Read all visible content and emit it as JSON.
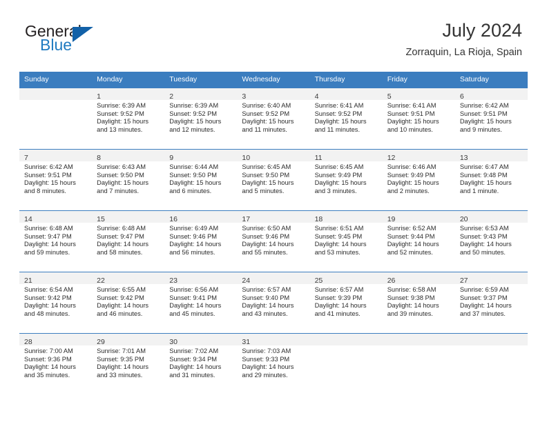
{
  "brand": {
    "name_part1": "General",
    "name_part2": "Blue",
    "flag_icon": "blue-triangle-flag-icon",
    "accent_color": "#1261a8",
    "text_color": "#231f20"
  },
  "header": {
    "title": "July 2024",
    "subtitle": "Zorraquin, La Rioja, Spain"
  },
  "theme": {
    "header_row_bg": "#3b7dbf",
    "header_row_text": "#ffffff",
    "daynum_band_bg": "#f2f2f2",
    "cell_border": "#3b7dbf",
    "body_text": "#2b2b2b"
  },
  "weekday_headers": [
    "Sunday",
    "Monday",
    "Tuesday",
    "Wednesday",
    "Thursday",
    "Friday",
    "Saturday"
  ],
  "labels": {
    "sunrise_prefix": "Sunrise:",
    "sunset_prefix": "Sunset:",
    "daylight_prefix": "Daylight:"
  },
  "weeks": [
    [
      {
        "day": "",
        "sunrise": "",
        "sunset": "",
        "daylight_line1": "",
        "daylight_line2": ""
      },
      {
        "day": "1",
        "sunrise": "Sunrise: 6:39 AM",
        "sunset": "Sunset: 9:52 PM",
        "daylight_line1": "Daylight: 15 hours",
        "daylight_line2": "and 13 minutes."
      },
      {
        "day": "2",
        "sunrise": "Sunrise: 6:39 AM",
        "sunset": "Sunset: 9:52 PM",
        "daylight_line1": "Daylight: 15 hours",
        "daylight_line2": "and 12 minutes."
      },
      {
        "day": "3",
        "sunrise": "Sunrise: 6:40 AM",
        "sunset": "Sunset: 9:52 PM",
        "daylight_line1": "Daylight: 15 hours",
        "daylight_line2": "and 11 minutes."
      },
      {
        "day": "4",
        "sunrise": "Sunrise: 6:41 AM",
        "sunset": "Sunset: 9:52 PM",
        "daylight_line1": "Daylight: 15 hours",
        "daylight_line2": "and 11 minutes."
      },
      {
        "day": "5",
        "sunrise": "Sunrise: 6:41 AM",
        "sunset": "Sunset: 9:51 PM",
        "daylight_line1": "Daylight: 15 hours",
        "daylight_line2": "and 10 minutes."
      },
      {
        "day": "6",
        "sunrise": "Sunrise: 6:42 AM",
        "sunset": "Sunset: 9:51 PM",
        "daylight_line1": "Daylight: 15 hours",
        "daylight_line2": "and 9 minutes."
      }
    ],
    [
      {
        "day": "7",
        "sunrise": "Sunrise: 6:42 AM",
        "sunset": "Sunset: 9:51 PM",
        "daylight_line1": "Daylight: 15 hours",
        "daylight_line2": "and 8 minutes."
      },
      {
        "day": "8",
        "sunrise": "Sunrise: 6:43 AM",
        "sunset": "Sunset: 9:50 PM",
        "daylight_line1": "Daylight: 15 hours",
        "daylight_line2": "and 7 minutes."
      },
      {
        "day": "9",
        "sunrise": "Sunrise: 6:44 AM",
        "sunset": "Sunset: 9:50 PM",
        "daylight_line1": "Daylight: 15 hours",
        "daylight_line2": "and 6 minutes."
      },
      {
        "day": "10",
        "sunrise": "Sunrise: 6:45 AM",
        "sunset": "Sunset: 9:50 PM",
        "daylight_line1": "Daylight: 15 hours",
        "daylight_line2": "and 5 minutes."
      },
      {
        "day": "11",
        "sunrise": "Sunrise: 6:45 AM",
        "sunset": "Sunset: 9:49 PM",
        "daylight_line1": "Daylight: 15 hours",
        "daylight_line2": "and 3 minutes."
      },
      {
        "day": "12",
        "sunrise": "Sunrise: 6:46 AM",
        "sunset": "Sunset: 9:49 PM",
        "daylight_line1": "Daylight: 15 hours",
        "daylight_line2": "and 2 minutes."
      },
      {
        "day": "13",
        "sunrise": "Sunrise: 6:47 AM",
        "sunset": "Sunset: 9:48 PM",
        "daylight_line1": "Daylight: 15 hours",
        "daylight_line2": "and 1 minute."
      }
    ],
    [
      {
        "day": "14",
        "sunrise": "Sunrise: 6:48 AM",
        "sunset": "Sunset: 9:47 PM",
        "daylight_line1": "Daylight: 14 hours",
        "daylight_line2": "and 59 minutes."
      },
      {
        "day": "15",
        "sunrise": "Sunrise: 6:48 AM",
        "sunset": "Sunset: 9:47 PM",
        "daylight_line1": "Daylight: 14 hours",
        "daylight_line2": "and 58 minutes."
      },
      {
        "day": "16",
        "sunrise": "Sunrise: 6:49 AM",
        "sunset": "Sunset: 9:46 PM",
        "daylight_line1": "Daylight: 14 hours",
        "daylight_line2": "and 56 minutes."
      },
      {
        "day": "17",
        "sunrise": "Sunrise: 6:50 AM",
        "sunset": "Sunset: 9:46 PM",
        "daylight_line1": "Daylight: 14 hours",
        "daylight_line2": "and 55 minutes."
      },
      {
        "day": "18",
        "sunrise": "Sunrise: 6:51 AM",
        "sunset": "Sunset: 9:45 PM",
        "daylight_line1": "Daylight: 14 hours",
        "daylight_line2": "and 53 minutes."
      },
      {
        "day": "19",
        "sunrise": "Sunrise: 6:52 AM",
        "sunset": "Sunset: 9:44 PM",
        "daylight_line1": "Daylight: 14 hours",
        "daylight_line2": "and 52 minutes."
      },
      {
        "day": "20",
        "sunrise": "Sunrise: 6:53 AM",
        "sunset": "Sunset: 9:43 PM",
        "daylight_line1": "Daylight: 14 hours",
        "daylight_line2": "and 50 minutes."
      }
    ],
    [
      {
        "day": "21",
        "sunrise": "Sunrise: 6:54 AM",
        "sunset": "Sunset: 9:42 PM",
        "daylight_line1": "Daylight: 14 hours",
        "daylight_line2": "and 48 minutes."
      },
      {
        "day": "22",
        "sunrise": "Sunrise: 6:55 AM",
        "sunset": "Sunset: 9:42 PM",
        "daylight_line1": "Daylight: 14 hours",
        "daylight_line2": "and 46 minutes."
      },
      {
        "day": "23",
        "sunrise": "Sunrise: 6:56 AM",
        "sunset": "Sunset: 9:41 PM",
        "daylight_line1": "Daylight: 14 hours",
        "daylight_line2": "and 45 minutes."
      },
      {
        "day": "24",
        "sunrise": "Sunrise: 6:57 AM",
        "sunset": "Sunset: 9:40 PM",
        "daylight_line1": "Daylight: 14 hours",
        "daylight_line2": "and 43 minutes."
      },
      {
        "day": "25",
        "sunrise": "Sunrise: 6:57 AM",
        "sunset": "Sunset: 9:39 PM",
        "daylight_line1": "Daylight: 14 hours",
        "daylight_line2": "and 41 minutes."
      },
      {
        "day": "26",
        "sunrise": "Sunrise: 6:58 AM",
        "sunset": "Sunset: 9:38 PM",
        "daylight_line1": "Daylight: 14 hours",
        "daylight_line2": "and 39 minutes."
      },
      {
        "day": "27",
        "sunrise": "Sunrise: 6:59 AM",
        "sunset": "Sunset: 9:37 PM",
        "daylight_line1": "Daylight: 14 hours",
        "daylight_line2": "and 37 minutes."
      }
    ],
    [
      {
        "day": "28",
        "sunrise": "Sunrise: 7:00 AM",
        "sunset": "Sunset: 9:36 PM",
        "daylight_line1": "Daylight: 14 hours",
        "daylight_line2": "and 35 minutes."
      },
      {
        "day": "29",
        "sunrise": "Sunrise: 7:01 AM",
        "sunset": "Sunset: 9:35 PM",
        "daylight_line1": "Daylight: 14 hours",
        "daylight_line2": "and 33 minutes."
      },
      {
        "day": "30",
        "sunrise": "Sunrise: 7:02 AM",
        "sunset": "Sunset: 9:34 PM",
        "daylight_line1": "Daylight: 14 hours",
        "daylight_line2": "and 31 minutes."
      },
      {
        "day": "31",
        "sunrise": "Sunrise: 7:03 AM",
        "sunset": "Sunset: 9:33 PM",
        "daylight_line1": "Daylight: 14 hours",
        "daylight_line2": "and 29 minutes."
      },
      {
        "day": "",
        "sunrise": "",
        "sunset": "",
        "daylight_line1": "",
        "daylight_line2": ""
      },
      {
        "day": "",
        "sunrise": "",
        "sunset": "",
        "daylight_line1": "",
        "daylight_line2": ""
      },
      {
        "day": "",
        "sunrise": "",
        "sunset": "",
        "daylight_line1": "",
        "daylight_line2": ""
      }
    ]
  ]
}
